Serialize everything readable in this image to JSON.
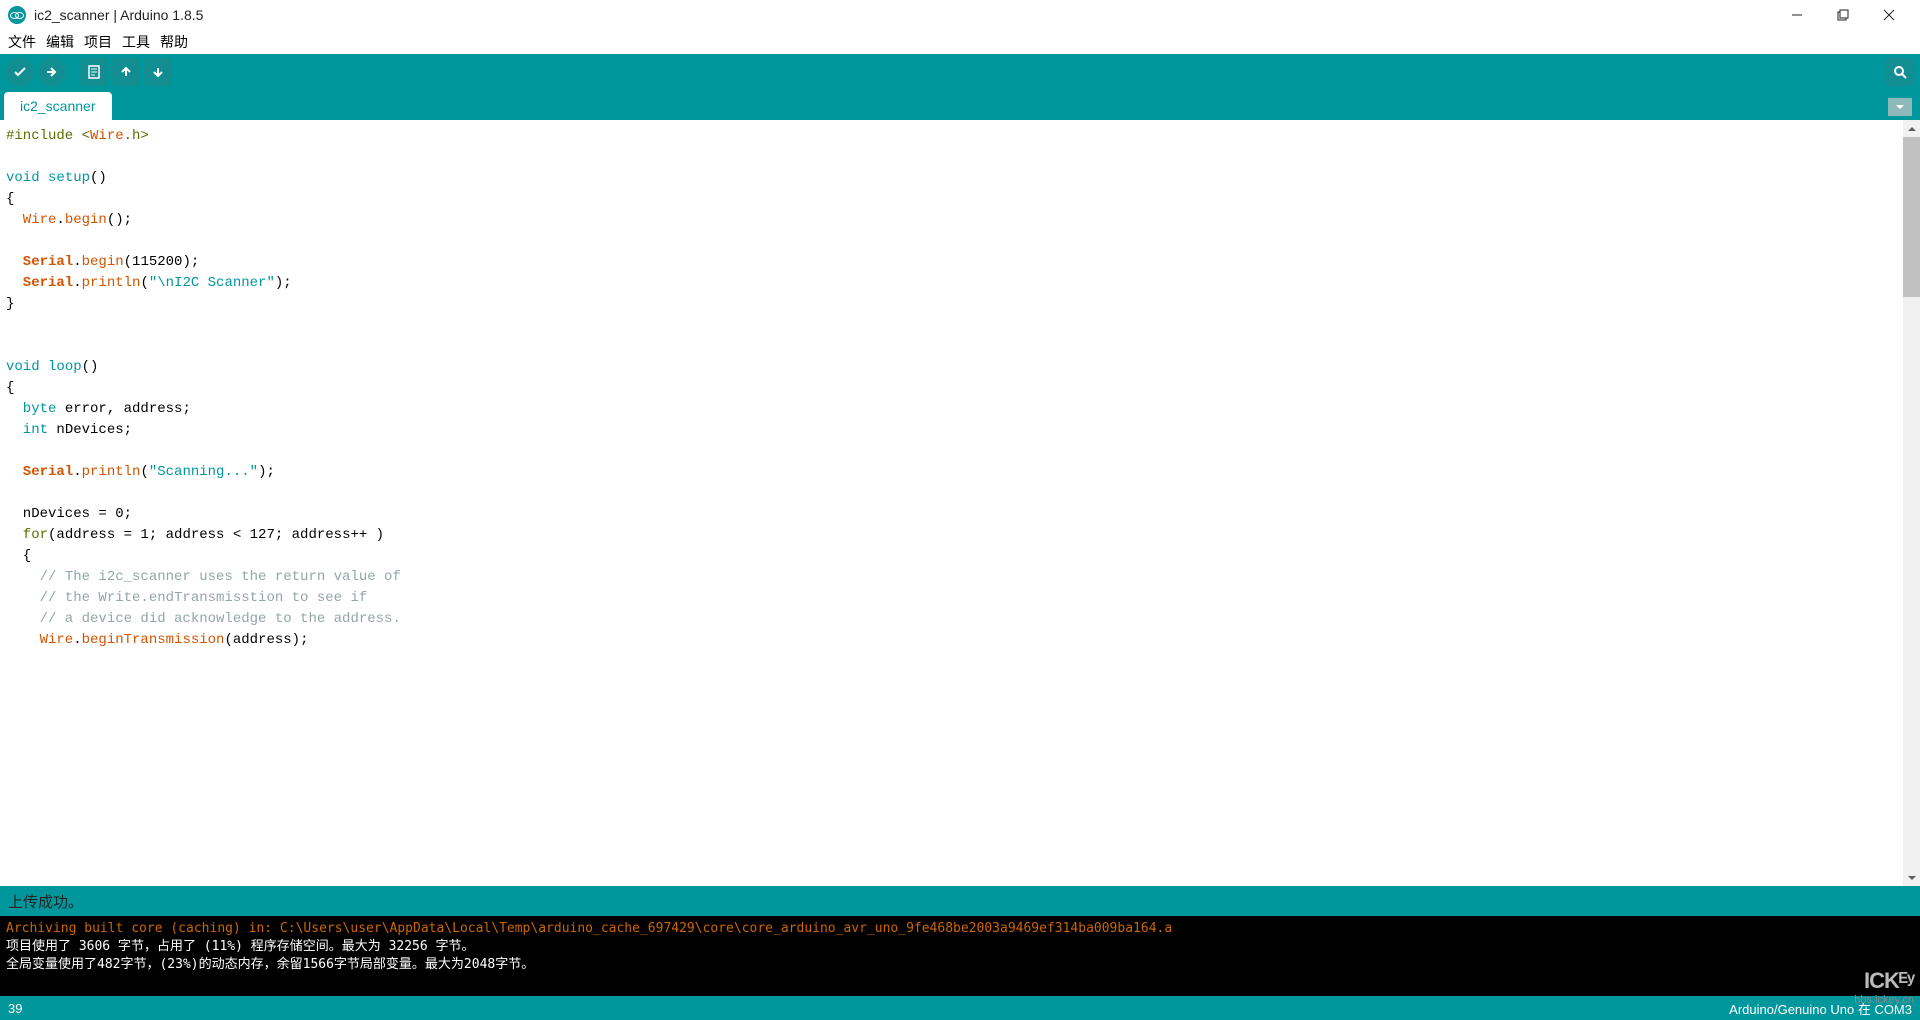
{
  "window": {
    "title": "ic2_scanner | Arduino 1.8.5"
  },
  "menu": {
    "file": "文件",
    "edit": "编辑",
    "sketch": "项目",
    "tools": "工具",
    "help": "帮助"
  },
  "tab": {
    "name": "ic2_scanner"
  },
  "status": {
    "message": "上传成功。"
  },
  "console": {
    "l1": "Archiving built core (caching) in: C:\\Users\\user\\AppData\\Local\\Temp\\arduino_cache_697429\\core\\core_arduino_avr_uno_9fe468be2003a9469ef314ba009ba164.a",
    "l2": "项目使用了 3606 字节，占用了 (11%) 程序存储空间。最大为 32256 字节。",
    "l3": "全局变量使用了482字节，(23%)的动态内存，余留1566字节局部变量。最大为2048字节。"
  },
  "footer": {
    "line": "39",
    "board": "Arduino/Genuino Uno 在 COM3"
  },
  "watermark": {
    "big": "ICKᴱʸ",
    "small": "bbs.ickey.cn"
  },
  "code": {
    "l1a": "#include <",
    "l1b": "Wire",
    "l1c": ".h>",
    "l3a": "void",
    "l3b": " setup",
    "l3c": "()",
    "l4": "{",
    "l5a": "  Wire",
    "l5b": ".",
    "l5c": "begin",
    "l5d": "();",
    "l7a": "  Serial",
    "l7b": ".",
    "l7c": "begin",
    "l7d": "(115200);",
    "l8a": "  Serial",
    "l8b": ".",
    "l8c": "println",
    "l8d": "(",
    "l8e": "\"\\nI2C Scanner\"",
    "l8f": ");",
    "l9": "}",
    "l12a": "void",
    "l12b": " loop",
    "l12c": "()",
    "l13": "{",
    "l14a": "  byte",
    "l14b": " error, address;",
    "l15a": "  int",
    "l15b": " nDevices;",
    "l17a": "  Serial",
    "l17b": ".",
    "l17c": "println",
    "l17d": "(",
    "l17e": "\"Scanning...\"",
    "l17f": ");",
    "l19": "  nDevices = 0;",
    "l20a": "  for",
    "l20b": "(address = 1; address < 127; address++ )",
    "l21": "  {",
    "l22": "    // The i2c_scanner uses the return value of",
    "l23": "    // the Write.endTransmisstion to see if",
    "l24": "    // a device did acknowledge to the address.",
    "l25a": "    Wire",
    "l25b": ".",
    "l25c": "beginTransmission",
    "l25d": "(address);"
  }
}
